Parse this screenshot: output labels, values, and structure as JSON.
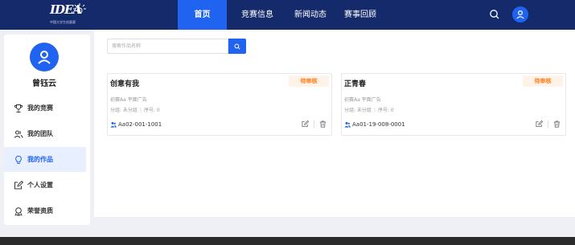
{
  "logo": {
    "mark": "IDEA",
    "subtitle": "中国大学生创意赛"
  },
  "nav": {
    "items": [
      {
        "label": "首页",
        "active": true
      },
      {
        "label": "竞赛信息",
        "active": false
      },
      {
        "label": "新闻动态",
        "active": false
      },
      {
        "label": "赛事回顾",
        "active": false
      }
    ]
  },
  "user": {
    "name": "曾钰云"
  },
  "sidebar": {
    "items": [
      {
        "label": "我的竞赛",
        "icon": "trophy-icon"
      },
      {
        "label": "我的团队",
        "icon": "team-icon"
      },
      {
        "label": "我的作品",
        "icon": "bulb-icon",
        "active": true
      },
      {
        "label": "个人设置",
        "icon": "edit-icon"
      },
      {
        "label": "荣誉资质",
        "icon": "medal-icon"
      }
    ]
  },
  "search": {
    "placeholder": "搜索作品名称"
  },
  "works": [
    {
      "title": "创意有我",
      "status": "待审核",
      "category": "初赛Aa 平面广告",
      "group_label": "分组: 未分组",
      "order_label": "序号: 0",
      "code": "Aa02-001-1001"
    },
    {
      "title": "正青春",
      "status": "待审核",
      "category": "初赛Aa 平面广告",
      "group_label": "分组: 未分组",
      "order_label": "序号: 0",
      "code": "Aa01-19-008-0001"
    }
  ],
  "colors": {
    "nav_bg": "#142a6b",
    "accent": "#1f63f0",
    "badge_text": "#ff7a1a",
    "badge_bg": "#fff2e6"
  }
}
